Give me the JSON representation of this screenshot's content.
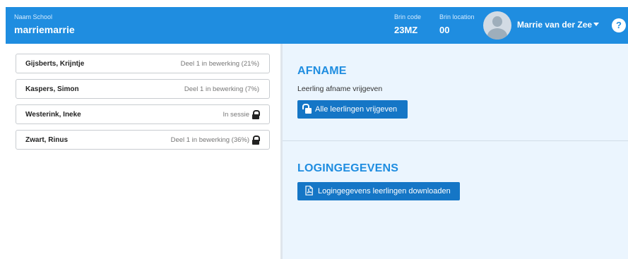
{
  "header": {
    "school_label": "Naam School",
    "school_name": "marriemarrie",
    "brin_code_label": "Brin code",
    "brin_code_value": "23MZ",
    "brin_location_label": "Brin location",
    "brin_location_value": "00",
    "user_name": "Marrie van der Zee",
    "help_label": "?"
  },
  "students": [
    {
      "name": "Gijsberts, Krijntje",
      "status": "Deel 1 in bewerking (21%)",
      "locked": false
    },
    {
      "name": "Kaspers, Simon",
      "status": "Deel 1 in bewerking (7%)",
      "locked": false
    },
    {
      "name": "Westerink, Ineke",
      "status": "In sessie",
      "locked": true
    },
    {
      "name": "Zwart, Rinus",
      "status": "Deel 1 in bewerking (36%)",
      "locked": true
    }
  ],
  "afname": {
    "title": "AFNAME",
    "subtitle": "Leerling afname vrijgeven",
    "button_label": "Alle leerlingen vrijgeven"
  },
  "logingegevens": {
    "title": "LOGINGEGEVENS",
    "button_label": "Logingegevens leerlingen downloaden"
  },
  "colors": {
    "header_bg": "#1f8de0",
    "accent": "#1f8de0",
    "button_bg": "#1576c6",
    "right_panel_bg": "#ebf5fe"
  },
  "icons": {
    "user": "avatar",
    "caret": "chevron-down-icon",
    "help": "help-icon",
    "locked": "lock-icon",
    "unlock": "unlock-icon",
    "pdf": "pdf-icon"
  }
}
